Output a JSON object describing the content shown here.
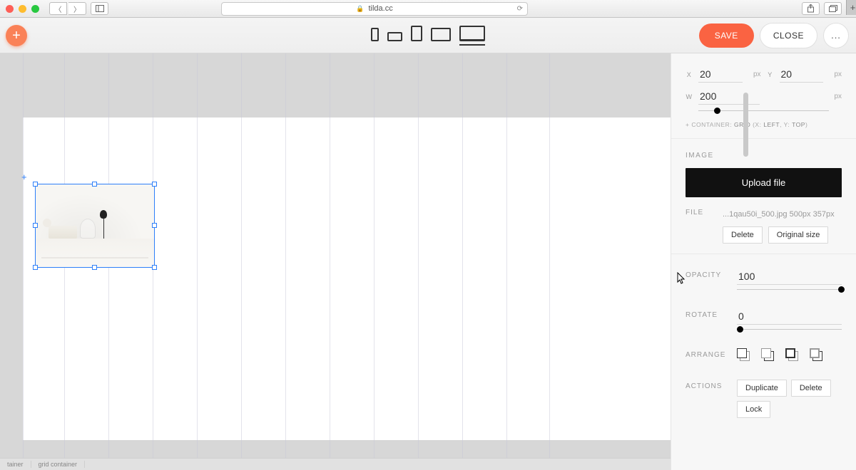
{
  "browser": {
    "url": "tilda.cc",
    "lock_icon": "🔒"
  },
  "toolbar": {
    "save_label": "SAVE",
    "close_label": "CLOSE",
    "more_label": "..."
  },
  "breadcrumbs": {
    "item0": "tainer",
    "item1": "grid container"
  },
  "inspector": {
    "position": {
      "x_label": "X",
      "x_value": "20",
      "y_label": "Y",
      "y_value": "20",
      "w_label": "W",
      "w_value": "200",
      "px": "px",
      "container_text_prefix": "+ CONTAINER: ",
      "container_grid": "GRID",
      "container_mid": " (X: ",
      "container_left": "LEFT",
      "container_mid2": ", Y: ",
      "container_top": "TOP",
      "container_suffix": ")"
    },
    "image": {
      "title": "IMAGE",
      "upload_label": "Upload file",
      "file_label": "FILE",
      "file_name": "...1qau50i_500.jpg 500px 357px",
      "delete_label": "Delete",
      "original_label": "Original size"
    },
    "opacity": {
      "label": "OPACITY",
      "value": "100"
    },
    "rotate": {
      "label": "ROTATE",
      "value": "0"
    },
    "arrange": {
      "label": "ARRANGE"
    },
    "actions": {
      "label": "ACTIONS",
      "duplicate": "Duplicate",
      "delete": "Delete",
      "lock": "Lock"
    }
  }
}
